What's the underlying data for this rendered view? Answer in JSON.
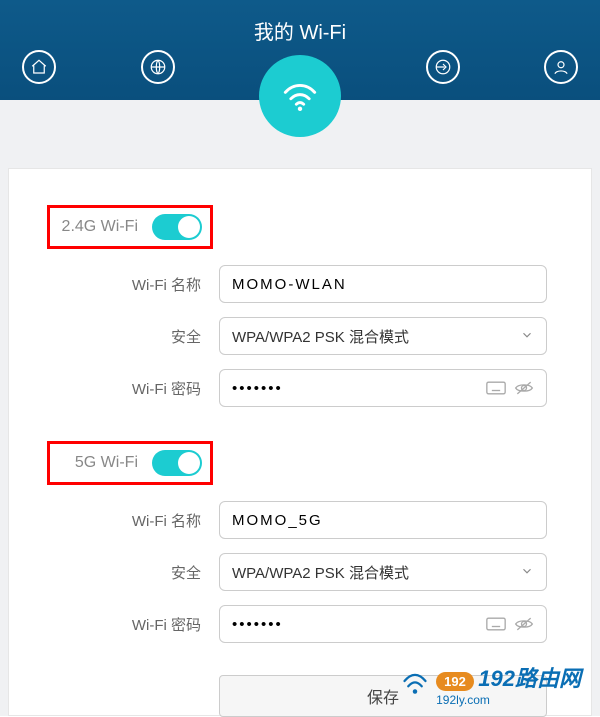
{
  "title": "我的 Wi-Fi",
  "wifi_24g": {
    "section_label": "2.4G Wi-Fi",
    "name_label": "Wi-Fi 名称",
    "name_value": "MOMO-WLAN",
    "security_label": "安全",
    "security_value": "WPA/WPA2 PSK 混合模式",
    "password_label": "Wi-Fi 密码",
    "password_value": "•••••••"
  },
  "wifi_5g": {
    "section_label": "5G Wi-Fi",
    "name_label": "Wi-Fi 名称",
    "name_value": "MOMO_5G",
    "security_label": "安全",
    "security_value": "WPA/WPA2 PSK 混合模式",
    "password_label": "Wi-Fi 密码",
    "password_value": "•••••••"
  },
  "save_label": "保存",
  "watermark": {
    "brand": "192路由网",
    "bubble": "192",
    "url": "192ly.com"
  }
}
